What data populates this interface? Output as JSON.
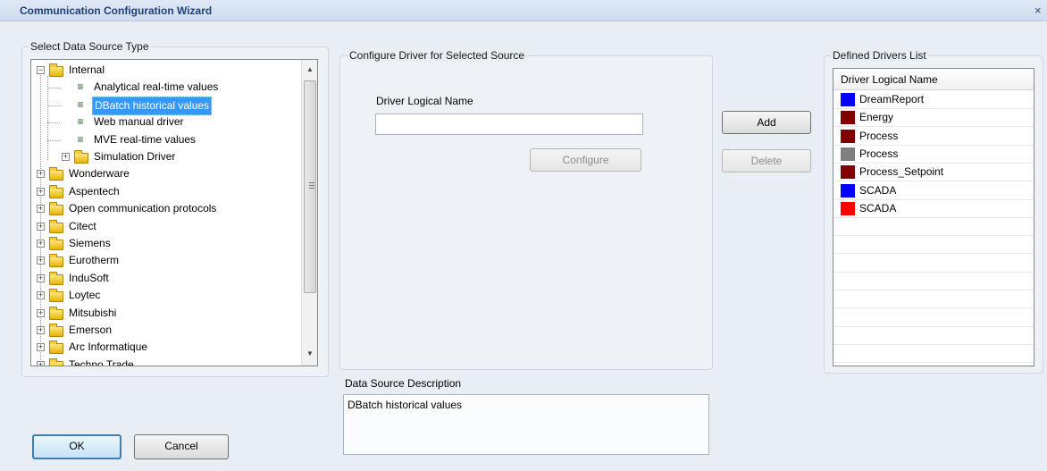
{
  "window": {
    "title": "Communication Configuration Wizard",
    "close_glyph": "×"
  },
  "source_type": {
    "group_label": "Select Data Source Type",
    "tree": [
      {
        "label": "Internal",
        "level": 0,
        "expanded": true,
        "kind": "folder"
      },
      {
        "label": "Analytical real-time values",
        "level": 1,
        "kind": "driver"
      },
      {
        "label": "DBatch historical values",
        "level": 1,
        "kind": "driver",
        "selected": true
      },
      {
        "label": "Web manual driver",
        "level": 1,
        "kind": "driver"
      },
      {
        "label": "MVE real-time values",
        "level": 1,
        "kind": "driver"
      },
      {
        "label": "Simulation Driver",
        "level": 1,
        "kind": "folder",
        "expanded": false
      },
      {
        "label": "Wonderware",
        "level": 0,
        "kind": "folder"
      },
      {
        "label": "Aspentech",
        "level": 0,
        "kind": "folder"
      },
      {
        "label": "Open communication protocols",
        "level": 0,
        "kind": "folder"
      },
      {
        "label": "Citect",
        "level": 0,
        "kind": "folder"
      },
      {
        "label": "Siemens",
        "level": 0,
        "kind": "folder"
      },
      {
        "label": "Eurotherm",
        "level": 0,
        "kind": "folder"
      },
      {
        "label": "InduSoft",
        "level": 0,
        "kind": "folder"
      },
      {
        "label": "Loytec",
        "level": 0,
        "kind": "folder"
      },
      {
        "label": "Mitsubishi",
        "level": 0,
        "kind": "folder"
      },
      {
        "label": "Emerson",
        "level": 0,
        "kind": "folder"
      },
      {
        "label": "Arc Informatique",
        "level": 0,
        "kind": "folder"
      },
      {
        "label": "Techno Trade",
        "level": 0,
        "kind": "folder"
      }
    ]
  },
  "configure": {
    "group_label": "Configure Driver for Selected Source",
    "field_label": "Driver Logical Name",
    "field_value": "",
    "configure_button": "Configure"
  },
  "actions": {
    "add": "Add",
    "delete": "Delete"
  },
  "drivers": {
    "group_label": "Defined Drivers List",
    "column_header": "Driver Logical Name",
    "rows": [
      {
        "name": "DreamReport",
        "color": "#0000ff"
      },
      {
        "name": "Energy",
        "color": "#800000"
      },
      {
        "name": "Process",
        "color": "#800000"
      },
      {
        "name": "Process",
        "color": "#808080"
      },
      {
        "name": "Process_Setpoint",
        "color": "#800000"
      },
      {
        "name": "SCADA",
        "color": "#0000ff"
      },
      {
        "name": "SCADA",
        "color": "#ff0000"
      }
    ],
    "empty_rows": 8
  },
  "description": {
    "label": "Data Source Description",
    "text": "DBatch historical values"
  },
  "footer": {
    "ok": "OK",
    "cancel": "Cancel"
  },
  "icons": {
    "folder": "folder-icon",
    "driver": "driver-icon",
    "expander_plus": "+",
    "expander_minus": "−"
  }
}
